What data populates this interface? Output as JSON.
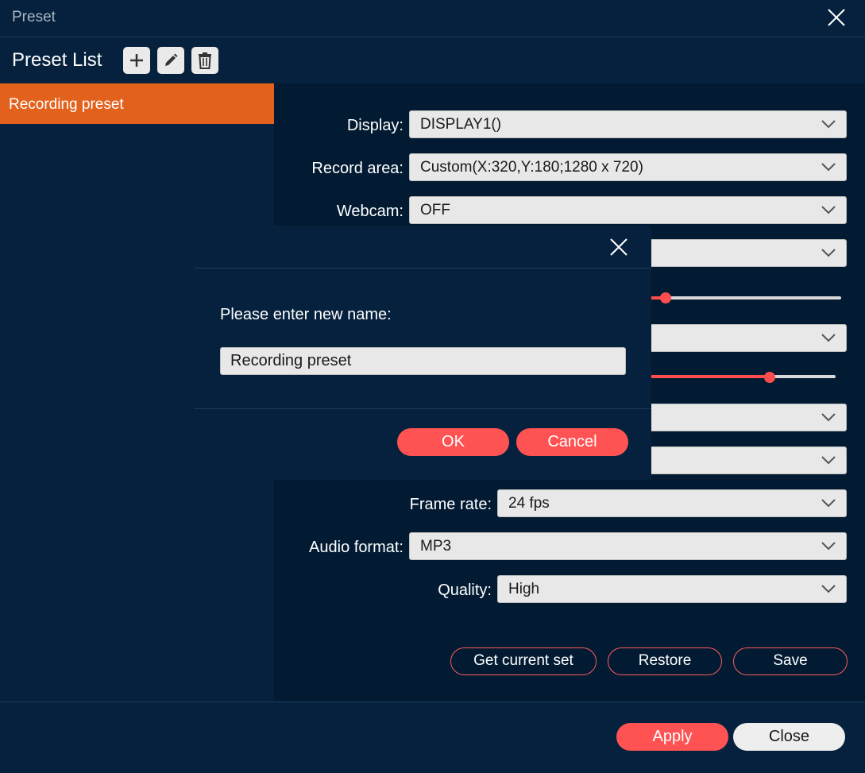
{
  "window": {
    "title": "Preset"
  },
  "preset_list": {
    "header": "Preset List",
    "items": [
      {
        "label": "Recording preset",
        "selected": true
      }
    ]
  },
  "settings": {
    "display": {
      "label": "Display:",
      "value": "DISPLAY1()"
    },
    "record_area": {
      "label": "Record area:",
      "value": "Custom(X:320,Y:180;1280 x 720)"
    },
    "webcam": {
      "label": "Webcam:",
      "value": "OFF"
    },
    "frame_rate": {
      "label": "Frame rate:",
      "value": "24 fps"
    },
    "audio_format": {
      "label": "Audio format:",
      "value": "MP3"
    },
    "quality": {
      "label": "Quality:",
      "value": "High"
    }
  },
  "actions": {
    "get_current_set": "Get current set",
    "restore": "Restore",
    "save": "Save"
  },
  "footer": {
    "apply": "Apply",
    "close": "Close"
  },
  "rename_dialog": {
    "prompt": "Please enter new name:",
    "name_value": "Recording preset",
    "ok": "OK",
    "cancel": "Cancel"
  },
  "colors": {
    "background": "#05213d",
    "accent": "#ff5353",
    "selected_item": "#e2621d"
  }
}
